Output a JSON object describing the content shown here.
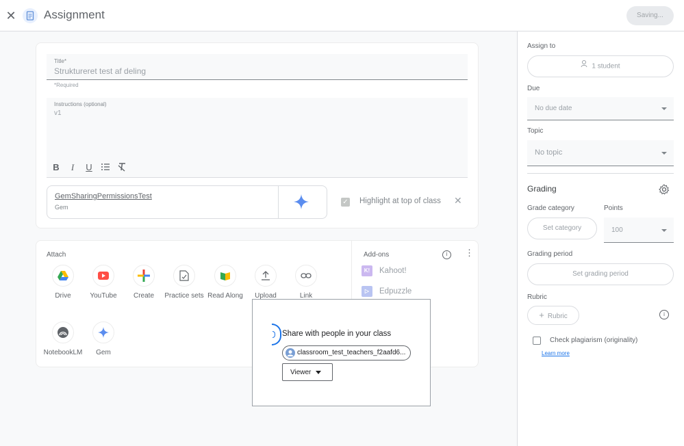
{
  "header": {
    "title": "Assignment",
    "saving_label": "Saving..."
  },
  "form": {
    "title_label": "Title*",
    "title_value": "Struktureret test af deling",
    "required_note": "*Required",
    "instructions_label": "Instructions (optional)",
    "instructions_value": "v1"
  },
  "gem": {
    "name": "GemSharingPermissionsTest",
    "type": "Gem",
    "highlight_label": "Highlight at top of class",
    "highlight_checked": true
  },
  "attach": {
    "label": "Attach",
    "items": [
      {
        "label": "Drive",
        "icon": "drive-icon"
      },
      {
        "label": "YouTube",
        "icon": "youtube-icon"
      },
      {
        "label": "Create",
        "icon": "plus-icon"
      },
      {
        "label": "Practice sets",
        "icon": "practice-sets-icon"
      },
      {
        "label": "Read Along",
        "icon": "read-along-icon"
      },
      {
        "label": "Upload",
        "icon": "upload-icon"
      },
      {
        "label": "Link",
        "icon": "link-icon"
      },
      {
        "label": "NotebookLM",
        "icon": "notebooklm-icon"
      },
      {
        "label": "Gem",
        "icon": "gem-sparkle-icon"
      }
    ]
  },
  "addons": {
    "label": "Add-ons",
    "items": [
      {
        "label": "Kahoot!",
        "icon": "kahoot-icon",
        "color": "#cbb8f0"
      },
      {
        "label": "Edpuzzle",
        "icon": "edpuzzle-icon",
        "color": "#b9c4f2"
      }
    ]
  },
  "share_dialog": {
    "message": "Share with people in your class",
    "recipient": "classroom_test_teachers_f2aafd6...",
    "permission": "Viewer"
  },
  "sidebar": {
    "assign_to_label": "Assign to",
    "assign_to_value": "1 student",
    "due_label": "Due",
    "due_value": "No due date",
    "topic_label": "Topic",
    "topic_value": "No topic",
    "grading_label": "Grading",
    "grade_category_label": "Grade category",
    "grade_category_value": "Set category",
    "points_label": "Points",
    "points_value": "100",
    "grading_period_label": "Grading period",
    "grading_period_value": "Set grading period",
    "rubric_label": "Rubric",
    "rubric_button": "Rubric",
    "plagiarism_label": "Check plagiarism (originality)",
    "learn_more": "Learn more"
  },
  "colors": {
    "accent": "#1a73e8",
    "muted_text": "#9aa0a6"
  }
}
